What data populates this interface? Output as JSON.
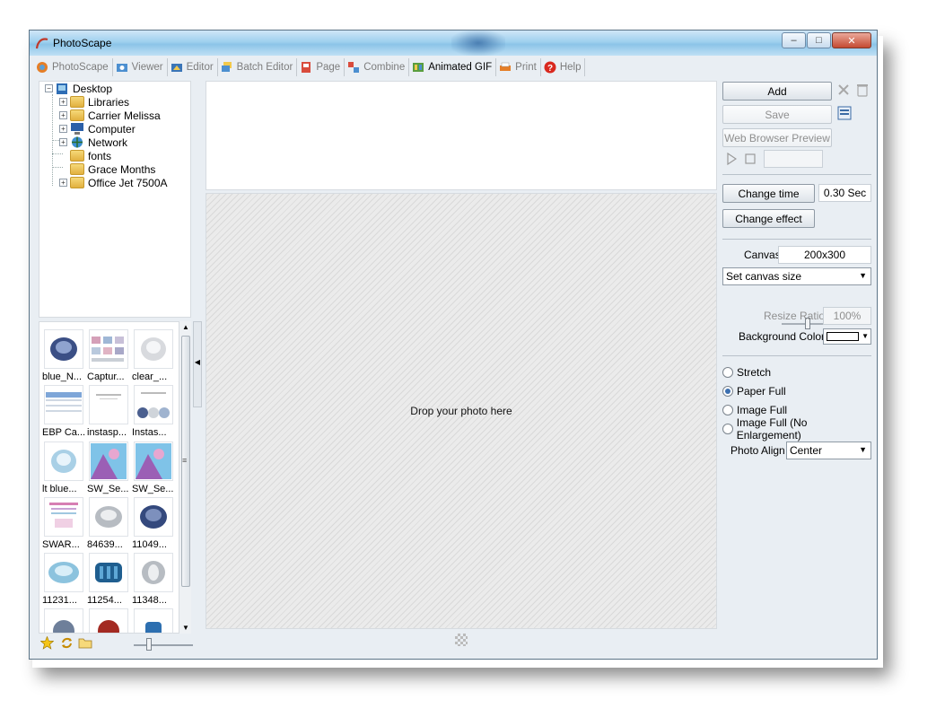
{
  "window": {
    "title": "PhotoScape"
  },
  "tabs": [
    {
      "label": "PhotoScape",
      "icon": "photoscape-icon"
    },
    {
      "label": "Viewer",
      "icon": "viewer-icon"
    },
    {
      "label": "Editor",
      "icon": "editor-icon"
    },
    {
      "label": "Batch Editor",
      "icon": "batch-editor-icon"
    },
    {
      "label": "Page",
      "icon": "page-icon"
    },
    {
      "label": "Combine",
      "icon": "combine-icon"
    },
    {
      "label": "Animated GIF",
      "icon": "animated-gif-icon",
      "active": true
    },
    {
      "label": "Print",
      "icon": "print-icon"
    },
    {
      "label": "Help",
      "icon": "help-icon"
    }
  ],
  "tree": {
    "root": "Desktop",
    "items": [
      "Libraries",
      "Carrier Melissa",
      "Computer",
      "Network",
      "fonts",
      "Grace Months",
      "Office Jet 7500A"
    ]
  },
  "thumbnails": [
    "blue_N...",
    "Captur...",
    "clear_...",
    "EBP Ca...",
    "instasp...",
    "Instas...",
    "lt blue...",
    "SW_Se...",
    "SW_Se...",
    "SWAR...",
    "84639...",
    "11049...",
    "11231...",
    "11254...",
    "11348..."
  ],
  "canvas": {
    "drop_hint": "Drop your photo here"
  },
  "right_panel": {
    "add": "Add",
    "save": "Save",
    "web_preview": "Web Browser Preview",
    "change_time": "Change time",
    "time_value": "0.30 Sec",
    "change_effect": "Change effect",
    "canvas_label": "Canvas",
    "canvas_value": "200x300",
    "canvas_size_select": "Set canvas size",
    "resize_ratio_label": "Resize Ratio",
    "resize_ratio_value": "100%",
    "bg_color_label": "Background Color",
    "bg_color": "#ffffff",
    "fit_options": [
      "Stretch",
      "Paper Full",
      "Image Full",
      "Image Full (No Enlargement)"
    ],
    "fit_selected": "Paper Full",
    "photo_align_label": "Photo Align",
    "photo_align_value": "Center"
  },
  "colors": {
    "accent": "#3b6fb0",
    "titlebar": "#9fd0ee"
  }
}
